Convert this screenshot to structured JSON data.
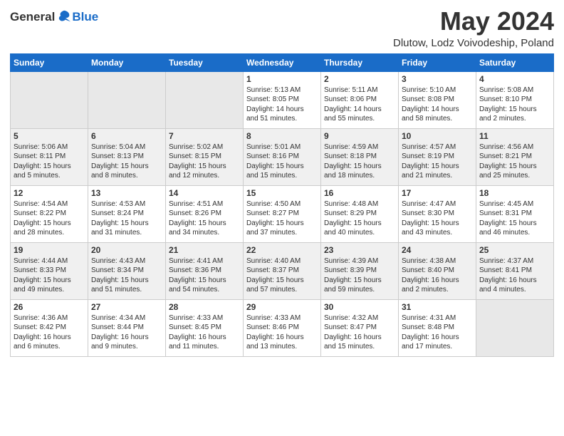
{
  "logo": {
    "general": "General",
    "blue": "Blue"
  },
  "header": {
    "month": "May 2024",
    "location": "Dlutow, Lodz Voivodeship, Poland"
  },
  "days_of_week": [
    "Sunday",
    "Monday",
    "Tuesday",
    "Wednesday",
    "Thursday",
    "Friday",
    "Saturday"
  ],
  "weeks": [
    {
      "days": [
        {
          "date": "",
          "sunrise": "",
          "sunset": "",
          "daylight": ""
        },
        {
          "date": "",
          "sunrise": "",
          "sunset": "",
          "daylight": ""
        },
        {
          "date": "",
          "sunrise": "",
          "sunset": "",
          "daylight": ""
        },
        {
          "date": "1",
          "sunrise": "Sunrise: 5:13 AM",
          "sunset": "Sunset: 8:05 PM",
          "daylight": "Daylight: 14 hours and 51 minutes."
        },
        {
          "date": "2",
          "sunrise": "Sunrise: 5:11 AM",
          "sunset": "Sunset: 8:06 PM",
          "daylight": "Daylight: 14 hours and 55 minutes."
        },
        {
          "date": "3",
          "sunrise": "Sunrise: 5:10 AM",
          "sunset": "Sunset: 8:08 PM",
          "daylight": "Daylight: 14 hours and 58 minutes."
        },
        {
          "date": "4",
          "sunrise": "Sunrise: 5:08 AM",
          "sunset": "Sunset: 8:10 PM",
          "daylight": "Daylight: 15 hours and 2 minutes."
        }
      ]
    },
    {
      "days": [
        {
          "date": "5",
          "sunrise": "Sunrise: 5:06 AM",
          "sunset": "Sunset: 8:11 PM",
          "daylight": "Daylight: 15 hours and 5 minutes."
        },
        {
          "date": "6",
          "sunrise": "Sunrise: 5:04 AM",
          "sunset": "Sunset: 8:13 PM",
          "daylight": "Daylight: 15 hours and 8 minutes."
        },
        {
          "date": "7",
          "sunrise": "Sunrise: 5:02 AM",
          "sunset": "Sunset: 8:15 PM",
          "daylight": "Daylight: 15 hours and 12 minutes."
        },
        {
          "date": "8",
          "sunrise": "Sunrise: 5:01 AM",
          "sunset": "Sunset: 8:16 PM",
          "daylight": "Daylight: 15 hours and 15 minutes."
        },
        {
          "date": "9",
          "sunrise": "Sunrise: 4:59 AM",
          "sunset": "Sunset: 8:18 PM",
          "daylight": "Daylight: 15 hours and 18 minutes."
        },
        {
          "date": "10",
          "sunrise": "Sunrise: 4:57 AM",
          "sunset": "Sunset: 8:19 PM",
          "daylight": "Daylight: 15 hours and 21 minutes."
        },
        {
          "date": "11",
          "sunrise": "Sunrise: 4:56 AM",
          "sunset": "Sunset: 8:21 PM",
          "daylight": "Daylight: 15 hours and 25 minutes."
        }
      ]
    },
    {
      "days": [
        {
          "date": "12",
          "sunrise": "Sunrise: 4:54 AM",
          "sunset": "Sunset: 8:22 PM",
          "daylight": "Daylight: 15 hours and 28 minutes."
        },
        {
          "date": "13",
          "sunrise": "Sunrise: 4:53 AM",
          "sunset": "Sunset: 8:24 PM",
          "daylight": "Daylight: 15 hours and 31 minutes."
        },
        {
          "date": "14",
          "sunrise": "Sunrise: 4:51 AM",
          "sunset": "Sunset: 8:26 PM",
          "daylight": "Daylight: 15 hours and 34 minutes."
        },
        {
          "date": "15",
          "sunrise": "Sunrise: 4:50 AM",
          "sunset": "Sunset: 8:27 PM",
          "daylight": "Daylight: 15 hours and 37 minutes."
        },
        {
          "date": "16",
          "sunrise": "Sunrise: 4:48 AM",
          "sunset": "Sunset: 8:29 PM",
          "daylight": "Daylight: 15 hours and 40 minutes."
        },
        {
          "date": "17",
          "sunrise": "Sunrise: 4:47 AM",
          "sunset": "Sunset: 8:30 PM",
          "daylight": "Daylight: 15 hours and 43 minutes."
        },
        {
          "date": "18",
          "sunrise": "Sunrise: 4:45 AM",
          "sunset": "Sunset: 8:31 PM",
          "daylight": "Daylight: 15 hours and 46 minutes."
        }
      ]
    },
    {
      "days": [
        {
          "date": "19",
          "sunrise": "Sunrise: 4:44 AM",
          "sunset": "Sunset: 8:33 PM",
          "daylight": "Daylight: 15 hours and 49 minutes."
        },
        {
          "date": "20",
          "sunrise": "Sunrise: 4:43 AM",
          "sunset": "Sunset: 8:34 PM",
          "daylight": "Daylight: 15 hours and 51 minutes."
        },
        {
          "date": "21",
          "sunrise": "Sunrise: 4:41 AM",
          "sunset": "Sunset: 8:36 PM",
          "daylight": "Daylight: 15 hours and 54 minutes."
        },
        {
          "date": "22",
          "sunrise": "Sunrise: 4:40 AM",
          "sunset": "Sunset: 8:37 PM",
          "daylight": "Daylight: 15 hours and 57 minutes."
        },
        {
          "date": "23",
          "sunrise": "Sunrise: 4:39 AM",
          "sunset": "Sunset: 8:39 PM",
          "daylight": "Daylight: 15 hours and 59 minutes."
        },
        {
          "date": "24",
          "sunrise": "Sunrise: 4:38 AM",
          "sunset": "Sunset: 8:40 PM",
          "daylight": "Daylight: 16 hours and 2 minutes."
        },
        {
          "date": "25",
          "sunrise": "Sunrise: 4:37 AM",
          "sunset": "Sunset: 8:41 PM",
          "daylight": "Daylight: 16 hours and 4 minutes."
        }
      ]
    },
    {
      "days": [
        {
          "date": "26",
          "sunrise": "Sunrise: 4:36 AM",
          "sunset": "Sunset: 8:42 PM",
          "daylight": "Daylight: 16 hours and 6 minutes."
        },
        {
          "date": "27",
          "sunrise": "Sunrise: 4:34 AM",
          "sunset": "Sunset: 8:44 PM",
          "daylight": "Daylight: 16 hours and 9 minutes."
        },
        {
          "date": "28",
          "sunrise": "Sunrise: 4:33 AM",
          "sunset": "Sunset: 8:45 PM",
          "daylight": "Daylight: 16 hours and 11 minutes."
        },
        {
          "date": "29",
          "sunrise": "Sunrise: 4:33 AM",
          "sunset": "Sunset: 8:46 PM",
          "daylight": "Daylight: 16 hours and 13 minutes."
        },
        {
          "date": "30",
          "sunrise": "Sunrise: 4:32 AM",
          "sunset": "Sunset: 8:47 PM",
          "daylight": "Daylight: 16 hours and 15 minutes."
        },
        {
          "date": "31",
          "sunrise": "Sunrise: 4:31 AM",
          "sunset": "Sunset: 8:48 PM",
          "daylight": "Daylight: 16 hours and 17 minutes."
        },
        {
          "date": "",
          "sunrise": "",
          "sunset": "",
          "daylight": ""
        }
      ]
    }
  ]
}
